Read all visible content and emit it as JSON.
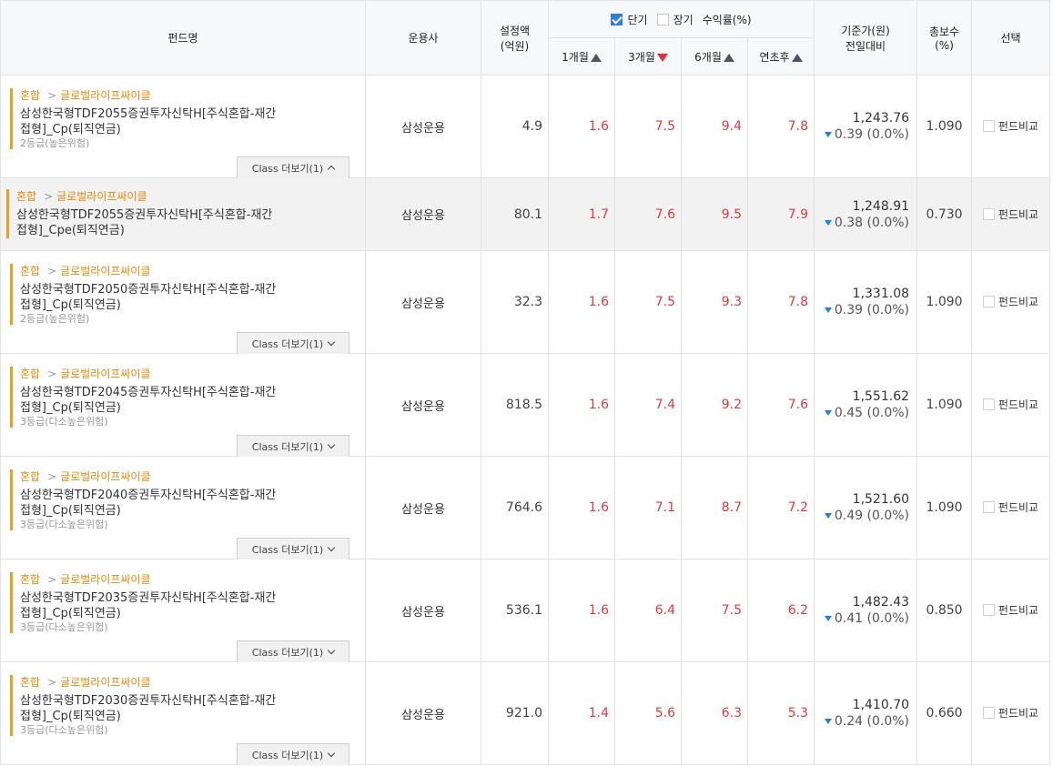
{
  "header": {
    "fund_name": "펀드명",
    "company": "운용사",
    "amount_l1": "설정액",
    "amount_l2": "(억원)",
    "opt_short": "단기",
    "opt_long": "장기",
    "return_label": "수익률(%)",
    "nav_l1": "기준가(원)",
    "nav_l2": "전일대비",
    "fee_l1": "총보수",
    "fee_l2": "(%)",
    "select": "선택",
    "p1": "1개월",
    "p3": "3개월",
    "p6": "6개월",
    "ytd": "연초후"
  },
  "rows": [
    {
      "cat": "혼합",
      "subcat": "글로벌라이프싸이클",
      "name": "삼성한국형TDF2055증권투자신탁H[주식혼합-재간접형]_Cp(퇴직연금)",
      "grade": "2등급(높은위험)",
      "class_btn": "Class 더보기(1)",
      "company": "삼성운용",
      "amount": "4.9",
      "r1": "1.6",
      "r3": "7.5",
      "r6": "9.4",
      "ytd": "7.8",
      "nav": "1,243.76",
      "chg": "0.39 (0.0%)",
      "fee": "1.090",
      "compare": "펀드비교"
    },
    {
      "cat": "혼합",
      "subcat": "글로벌라이프싸이클",
      "name": "삼성한국형TDF2055증권투자신탁H[주식혼합-재간접형]_Cpe(퇴직연금)",
      "company": "삼성운용",
      "amount": "80.1",
      "r1": "1.7",
      "r3": "7.6",
      "r6": "9.5",
      "ytd": "7.9",
      "nav": "1,248.91",
      "chg": "0.38 (0.0%)",
      "fee": "0.730",
      "compare": "펀드비교"
    },
    {
      "cat": "혼합",
      "subcat": "글로벌라이프싸이클",
      "name": "삼성한국형TDF2050증권투자신탁H[주식혼합-재간접형]_Cp(퇴직연금)",
      "grade": "2등급(높은위험)",
      "class_btn": "Class 더보기(1)",
      "company": "삼성운용",
      "amount": "32.3",
      "r1": "1.6",
      "r3": "7.5",
      "r6": "9.3",
      "ytd": "7.8",
      "nav": "1,331.08",
      "chg": "0.39 (0.0%)",
      "fee": "1.090",
      "compare": "펀드비교"
    },
    {
      "cat": "혼합",
      "subcat": "글로벌라이프싸이클",
      "name": "삼성한국형TDF2045증권투자신탁H[주식혼합-재간접형]_Cp(퇴직연금)",
      "grade": "3등급(다소높은위험)",
      "class_btn": "Class 더보기(1)",
      "company": "삼성운용",
      "amount": "818.5",
      "r1": "1.6",
      "r3": "7.4",
      "r6": "9.2",
      "ytd": "7.6",
      "nav": "1,551.62",
      "chg": "0.45 (0.0%)",
      "fee": "1.090",
      "compare": "펀드비교"
    },
    {
      "cat": "혼합",
      "subcat": "글로벌라이프싸이클",
      "name": "삼성한국형TDF2040증권투자신탁H[주식혼합-재간접형]_Cp(퇴직연금)",
      "grade": "3등급(다소높은위험)",
      "class_btn": "Class 더보기(1)",
      "company": "삼성운용",
      "amount": "764.6",
      "r1": "1.6",
      "r3": "7.1",
      "r6": "8.7",
      "ytd": "7.2",
      "nav": "1,521.60",
      "chg": "0.49 (0.0%)",
      "fee": "1.090",
      "compare": "펀드비교"
    },
    {
      "cat": "혼합",
      "subcat": "글로벌라이프싸이클",
      "name": "삼성한국형TDF2035증권투자신탁H[주식혼합-재간접형]_Cp(퇴직연금)",
      "grade": "3등급(다소높은위험)",
      "class_btn": "Class 더보기(1)",
      "company": "삼성운용",
      "amount": "536.1",
      "r1": "1.6",
      "r3": "6.4",
      "r6": "7.5",
      "ytd": "6.2",
      "nav": "1,482.43",
      "chg": "0.41 (0.0%)",
      "fee": "0.850",
      "compare": "펀드비교"
    },
    {
      "cat": "혼합",
      "subcat": "글로벌라이프싸이클",
      "name": "삼성한국형TDF2030증권투자신탁H[주식혼합-재간접형]_Cp(퇴직연금)",
      "grade": "3등급(다소높은위험)",
      "class_btn": "Class 더보기(1)",
      "company": "삼성운용",
      "amount": "921.0",
      "r1": "1.4",
      "r3": "5.6",
      "r6": "6.3",
      "ytd": "5.3",
      "nav": "1,410.70",
      "chg": "0.24 (0.0%)",
      "fee": "0.660",
      "compare": "펀드비교"
    }
  ],
  "colors": {
    "accent": "#f29d1d",
    "positive": "#e5393a",
    "down": "#1f82d6",
    "checkbox": "#2f7de1"
  }
}
